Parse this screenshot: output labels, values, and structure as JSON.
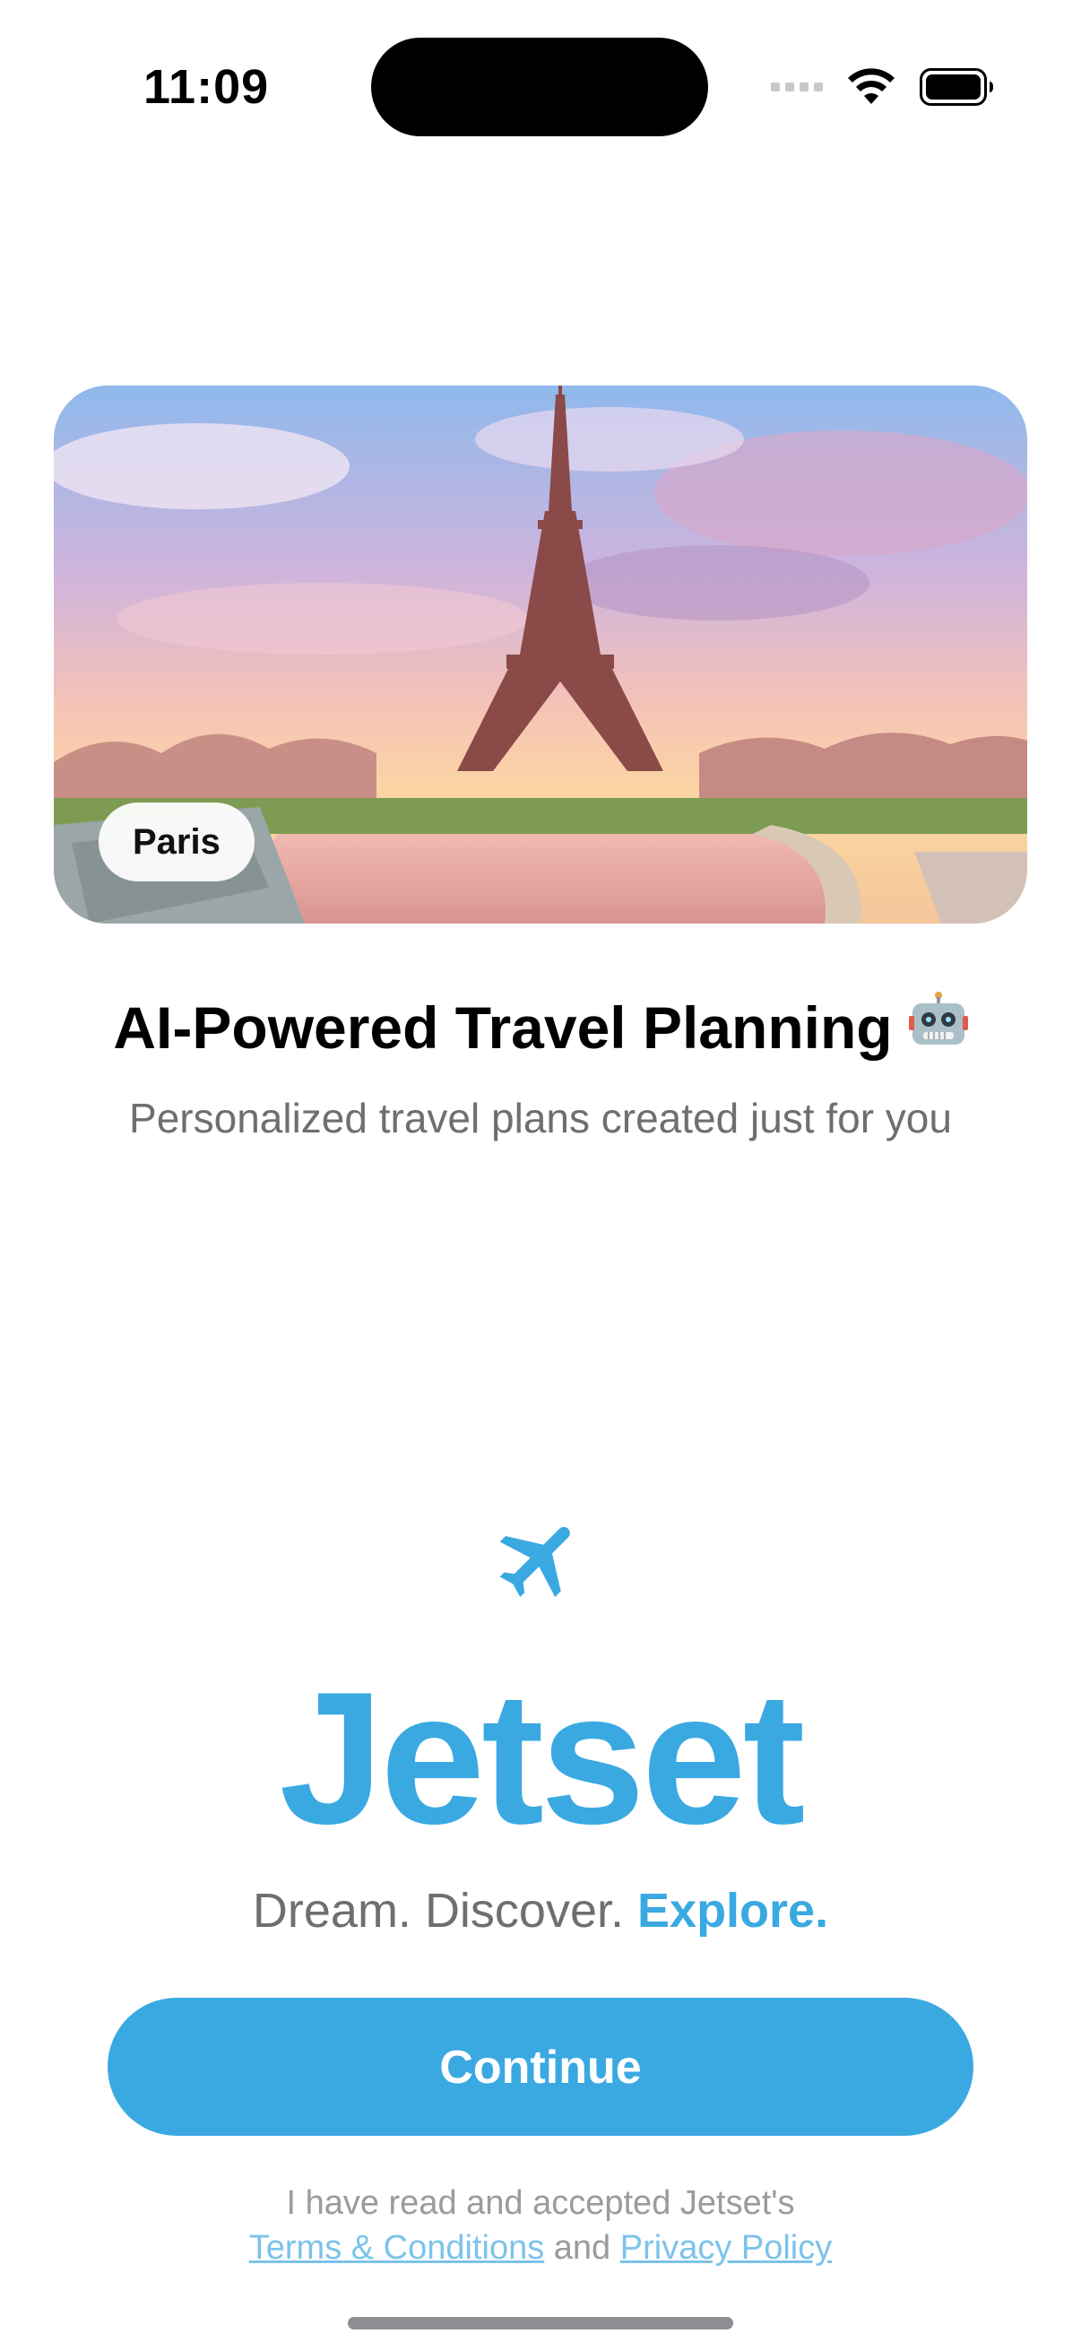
{
  "status_bar": {
    "time": "11:09",
    "icons": [
      "cellular-signal-icon",
      "wifi-icon",
      "battery-icon"
    ]
  },
  "hero": {
    "city_label": "Paris",
    "image_subject": "eiffel-tower-sunset-image"
  },
  "headline": {
    "title": "AI-Powered Travel Planning",
    "title_icon": "robot-icon",
    "subtitle": "Personalized travel plans created just for you"
  },
  "brand": {
    "icon": "airplane-icon",
    "name": "Jetset",
    "tagline_part1": "Dream. Discover. ",
    "tagline_accent": "Explore."
  },
  "actions": {
    "continue_label": "Continue"
  },
  "legal": {
    "line1": "I have read and accepted Jetset's",
    "terms_link": "Terms & Conditions",
    "and_text": "and",
    "privacy_link": "Privacy Policy"
  },
  "colors": {
    "accent": "#3aa9e2",
    "text_primary": "#000000",
    "text_secondary": "#6e6e73",
    "link": "#7cc3ea"
  }
}
